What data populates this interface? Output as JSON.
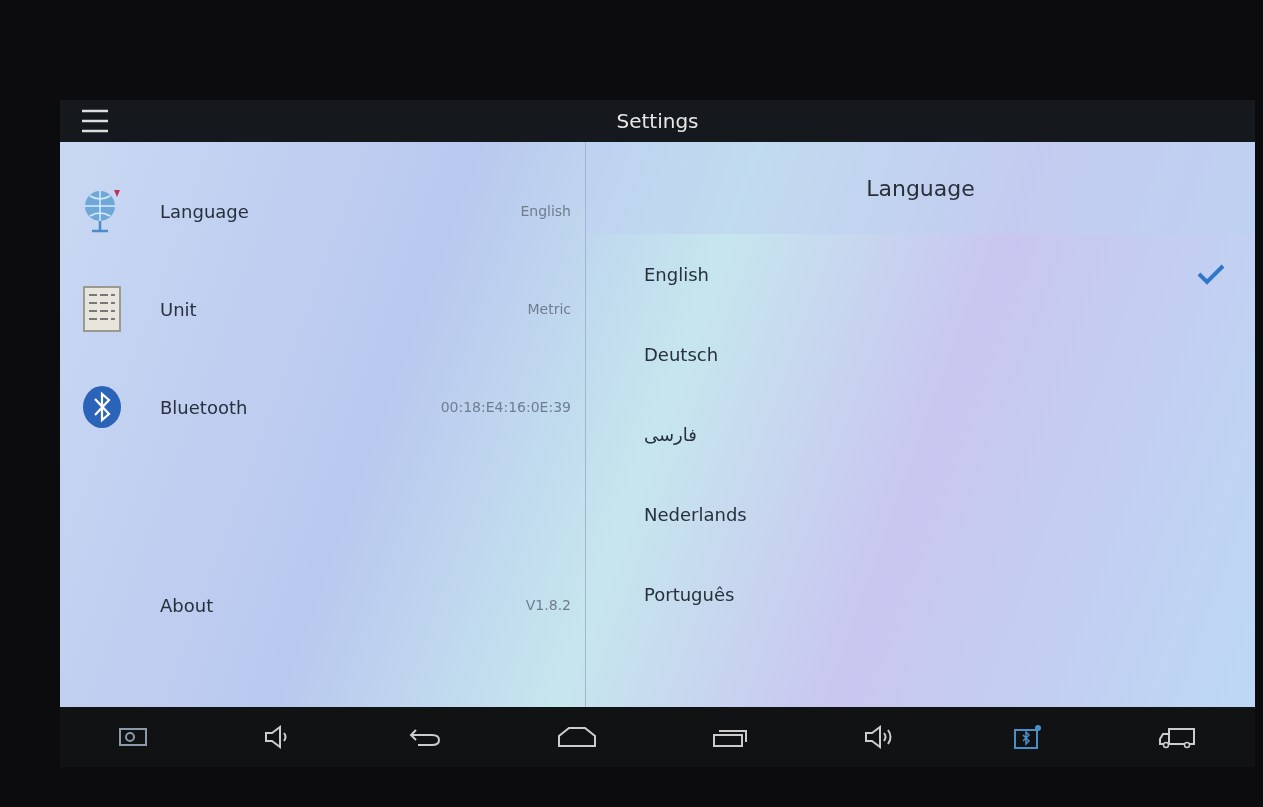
{
  "top_bar": {
    "title": "Settings"
  },
  "settings": [
    {
      "kind": "globe",
      "label": "Language",
      "value": "English"
    },
    {
      "kind": "list",
      "label": "Unit",
      "value": "Metric"
    },
    {
      "kind": "bluetooth",
      "label": "Bluetooth",
      "value": "00:18:E4:16:0E:39"
    },
    {
      "kind": "blank",
      "label": "About",
      "value": "V1.8.2"
    }
  ],
  "language_panel": {
    "title": "Language",
    "options": [
      {
        "label": "English",
        "selected": true
      },
      {
        "label": "Deutsch",
        "selected": false
      },
      {
        "label": "فارسی",
        "selected": false
      },
      {
        "label": "Nederlands",
        "selected": false
      },
      {
        "label": "Português",
        "selected": false
      }
    ]
  }
}
